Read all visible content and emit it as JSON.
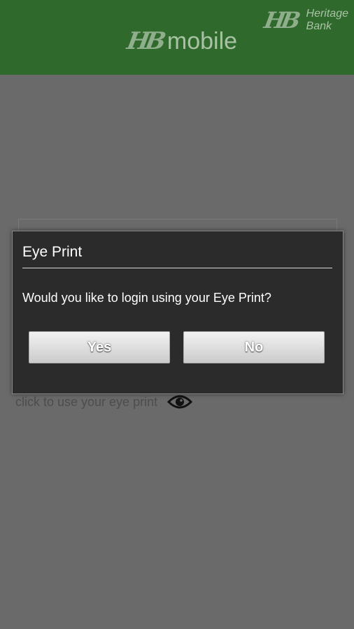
{
  "header": {
    "logo_mark": "HB",
    "logo_word": "mobile",
    "bank_mark": "HB",
    "bank_name_line1": "Heritage",
    "bank_name_line2": "Bank",
    "background_color": "#2f6a2c"
  },
  "background": {
    "eye_print_hint": "click to use your eye print",
    "eye_icon": "eye-icon"
  },
  "dialog": {
    "title": "Eye Print",
    "message": "Would you like to login using your Eye Print?",
    "yes_label": "Yes",
    "no_label": "No"
  }
}
